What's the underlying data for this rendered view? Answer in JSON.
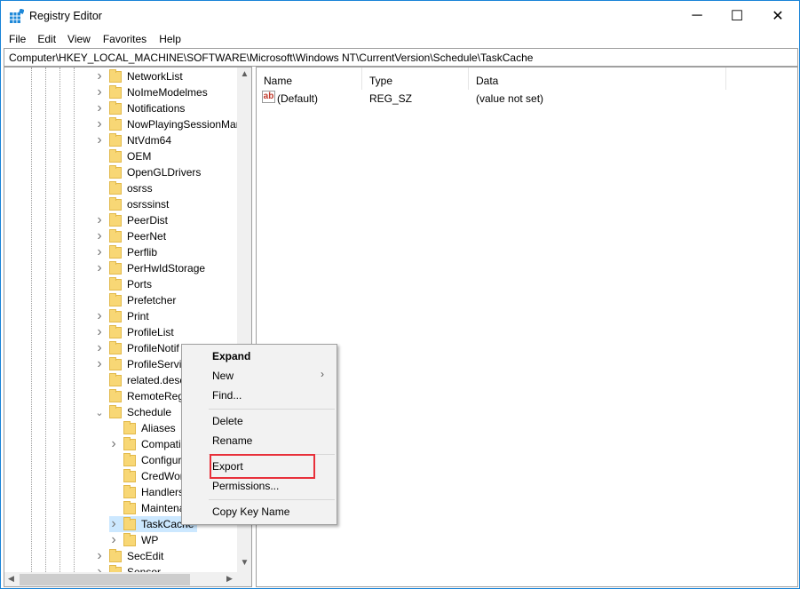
{
  "window": {
    "title": "Registry Editor",
    "minimize": "─",
    "maximize": "☐",
    "close": "✕"
  },
  "menu": [
    "File",
    "Edit",
    "View",
    "Favorites",
    "Help"
  ],
  "address": "Computer\\HKEY_LOCAL_MACHINE\\SOFTWARE\\Microsoft\\Windows NT\\CurrentVersion\\Schedule\\TaskCache",
  "tree": [
    {
      "label": "NetworkList",
      "level": 1,
      "exp": ">"
    },
    {
      "label": "NoImeModelmes",
      "level": 1,
      "exp": ">"
    },
    {
      "label": "Notifications",
      "level": 1,
      "exp": ">"
    },
    {
      "label": "NowPlayingSessionManager",
      "level": 1,
      "exp": ">"
    },
    {
      "label": "NtVdm64",
      "level": 1,
      "exp": ">"
    },
    {
      "label": "OEM",
      "level": 1,
      "exp": ""
    },
    {
      "label": "OpenGLDrivers",
      "level": 1,
      "exp": ""
    },
    {
      "label": "osrss",
      "level": 1,
      "exp": ""
    },
    {
      "label": "osrssinst",
      "level": 1,
      "exp": ""
    },
    {
      "label": "PeerDist",
      "level": 1,
      "exp": ">"
    },
    {
      "label": "PeerNet",
      "level": 1,
      "exp": ">"
    },
    {
      "label": "Perflib",
      "level": 1,
      "exp": ">"
    },
    {
      "label": "PerHwIdStorage",
      "level": 1,
      "exp": ">"
    },
    {
      "label": "Ports",
      "level": 1,
      "exp": ""
    },
    {
      "label": "Prefetcher",
      "level": 1,
      "exp": ""
    },
    {
      "label": "Print",
      "level": 1,
      "exp": ">"
    },
    {
      "label": "ProfileList",
      "level": 1,
      "exp": ">"
    },
    {
      "label": "ProfileNotif",
      "level": 1,
      "exp": ">"
    },
    {
      "label": "ProfileServic",
      "level": 1,
      "exp": ">"
    },
    {
      "label": "related.desc",
      "level": 1,
      "exp": ""
    },
    {
      "label": "RemoteReg",
      "level": 1,
      "exp": ""
    },
    {
      "label": "Schedule",
      "level": 1,
      "exp": "v"
    },
    {
      "label": "Aliases",
      "level": 2,
      "exp": ""
    },
    {
      "label": "Compati",
      "level": 2,
      "exp": ">"
    },
    {
      "label": "Configur",
      "level": 2,
      "exp": ""
    },
    {
      "label": "CredWor",
      "level": 2,
      "exp": ""
    },
    {
      "label": "Handlers",
      "level": 2,
      "exp": ""
    },
    {
      "label": "Maintena",
      "level": 2,
      "exp": ""
    },
    {
      "label": "TaskCache",
      "level": 2,
      "exp": ">",
      "selected": true
    },
    {
      "label": "WP",
      "level": 2,
      "exp": ">"
    },
    {
      "label": "SecEdit",
      "level": 1,
      "exp": ">"
    },
    {
      "label": "Sensor",
      "level": 1,
      "exp": ">"
    }
  ],
  "list": {
    "headers": [
      "Name",
      "Type",
      "Data"
    ],
    "rows": [
      {
        "name": "(Default)",
        "type": "REG_SZ",
        "data": "(value not set)",
        "icon": "string-value-icon"
      }
    ]
  },
  "context_menu": {
    "items": [
      "Expand",
      "New",
      "Find...",
      "Delete",
      "Rename",
      "Export",
      "Permissions...",
      "Copy Key Name"
    ],
    "highlighted": "Export",
    "highlight_color": "#e8303a"
  }
}
